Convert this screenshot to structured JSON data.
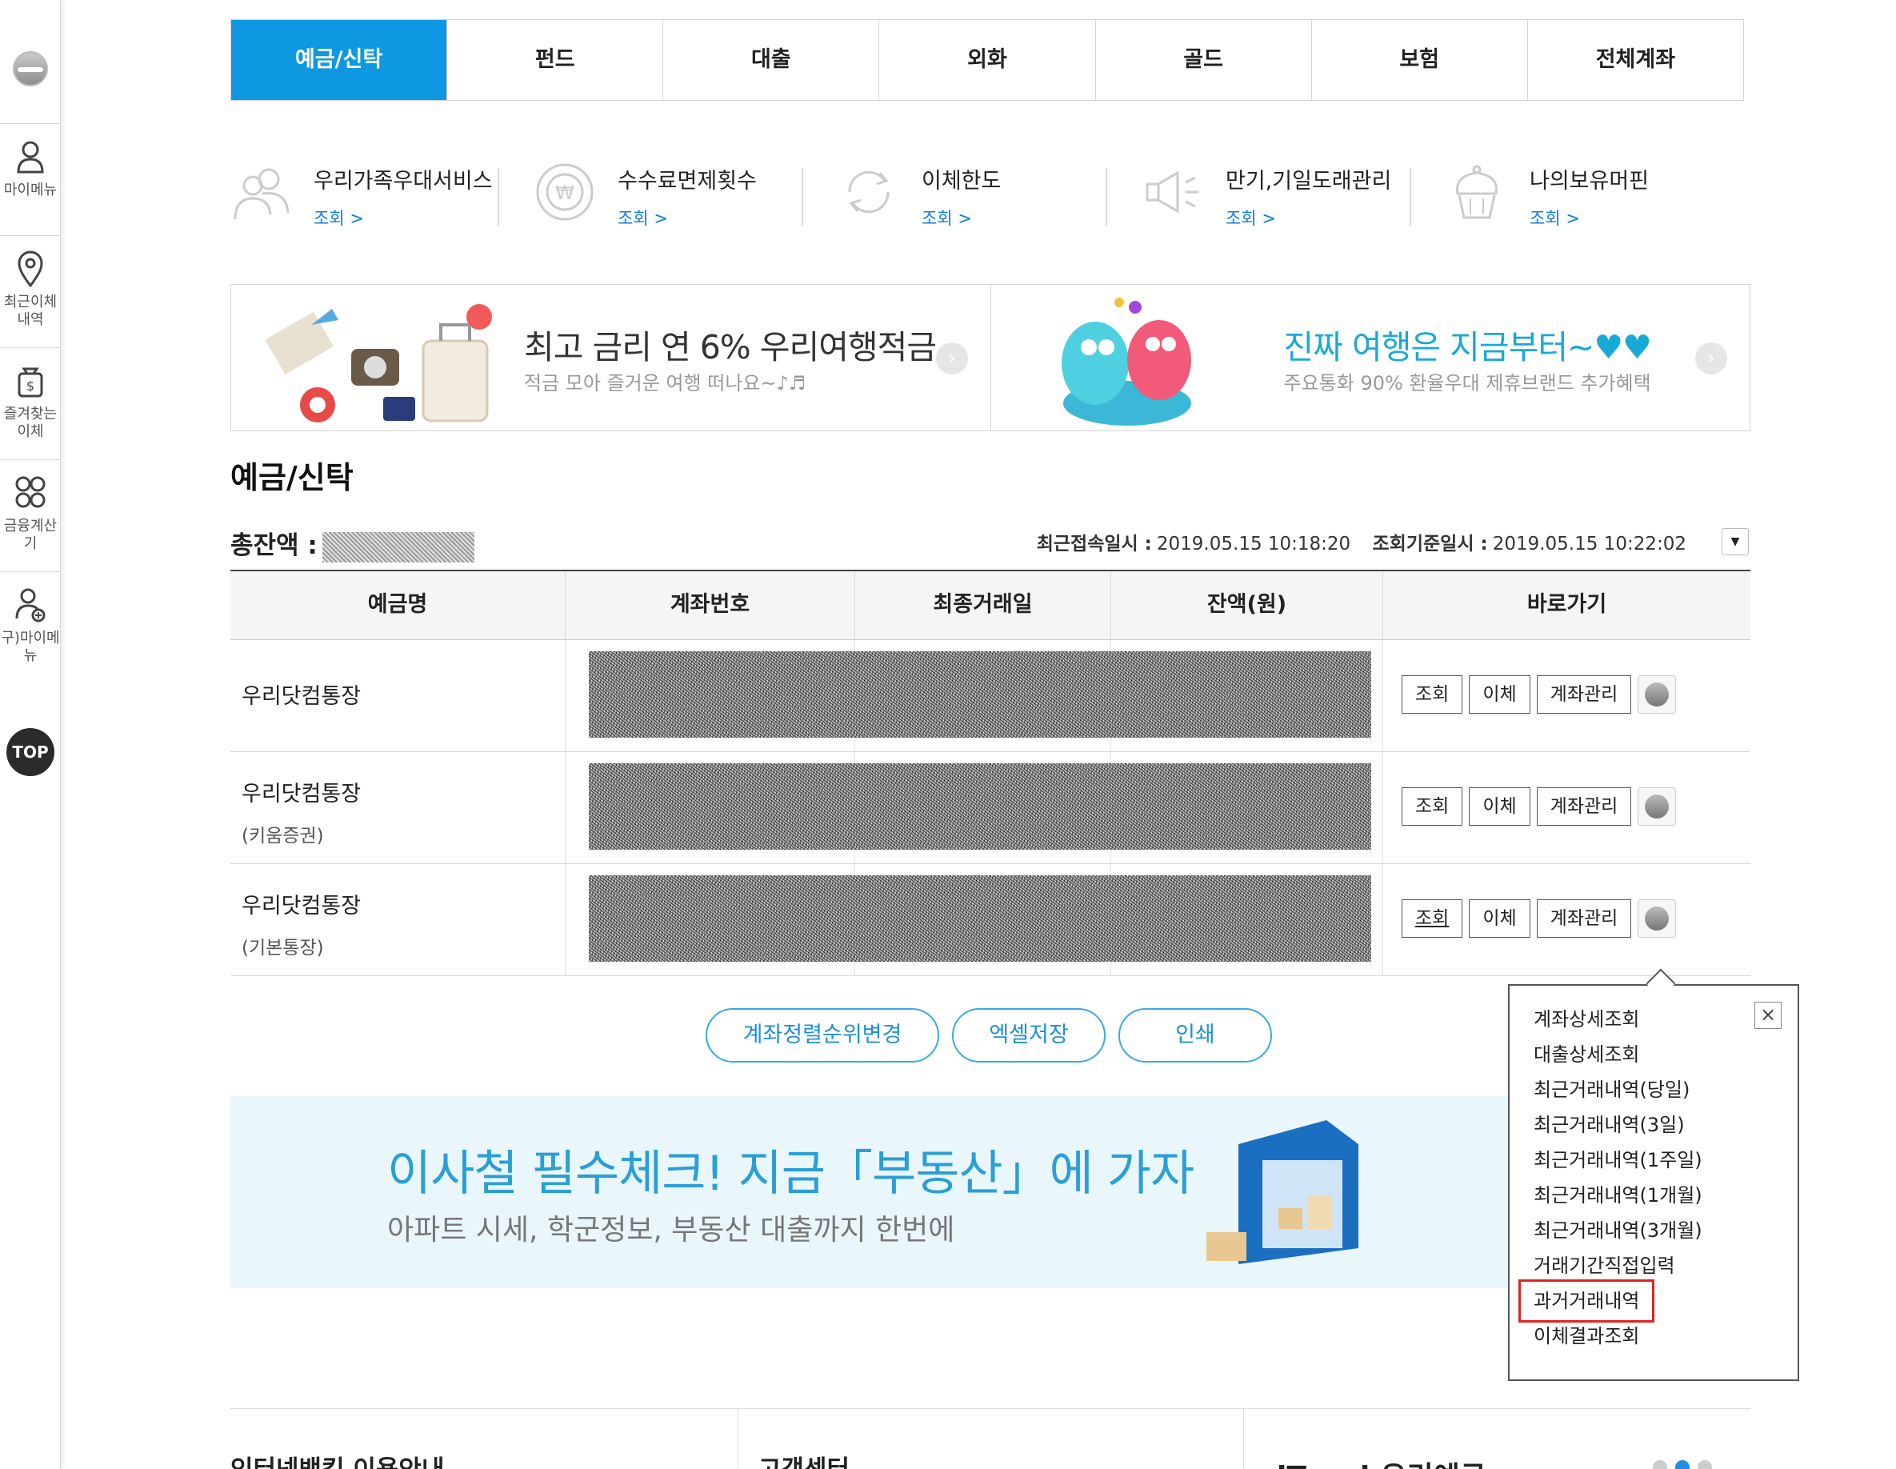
{
  "sidebar": {
    "items": [
      {
        "label": "마이메뉴",
        "icon": "person-icon"
      },
      {
        "label": "최근이체내역",
        "icon": "location-pin-icon"
      },
      {
        "label": "즐겨찾는이체",
        "icon": "money-bag-icon"
      },
      {
        "label": "금융계산기",
        "icon": "calculator-icon"
      },
      {
        "label": "구)마이메뉴",
        "icon": "person-add-icon"
      }
    ],
    "top": "TOP"
  },
  "tabs": [
    "예금/신탁",
    "펀드",
    "대출",
    "외화",
    "골드",
    "보험",
    "전체계좌"
  ],
  "quick": [
    {
      "title": "우리가족우대서비스",
      "link": "조회 >",
      "icon": "family-icon"
    },
    {
      "title": "수수료면제횟수",
      "link": "조회 >",
      "icon": "won-coin-icon"
    },
    {
      "title": "이체한도",
      "link": "조회 >",
      "icon": "refresh-icon"
    },
    {
      "title": "만기,기일도래관리",
      "link": "조회 >",
      "icon": "megaphone-icon"
    },
    {
      "title": "나의보유머핀",
      "link": "조회 >",
      "icon": "muffin-icon"
    }
  ],
  "banners": [
    {
      "title": "최고 금리 연 6% 우리여행적금",
      "sub": "적금 모아 즐거운 여행 떠나요~♪♬"
    },
    {
      "title": "진짜 여행은 지금부터~♥♥",
      "sub": "주요통화 90% 환율우대 제휴브랜드 추가혜택"
    }
  ],
  "section": {
    "title": "예금/신탁",
    "total_label": "총잔액 :",
    "last_access_label": "최근접속일시 :",
    "last_access": "2019.05.15 10:18:20",
    "query_time_label": "조회기준일시 :",
    "query_time": "2019.05.15 10:22:02"
  },
  "table": {
    "headers": [
      "예금명",
      "계좌번호",
      "최종거래일",
      "잔액(원)",
      "바로가기"
    ],
    "rows": [
      {
        "name": "우리닷컴통장",
        "sub": ""
      },
      {
        "name": "우리닷컴통장",
        "sub": "(키움증권)"
      },
      {
        "name": "우리닷컴통장",
        "sub": "(기본통장)"
      }
    ],
    "actions": {
      "view": "조회",
      "transfer": "이체",
      "manage": "계좌관리"
    }
  },
  "buttons": {
    "sort": "계좌정렬순위변경",
    "excel": "엑셀저장",
    "print": "인쇄"
  },
  "ad": {
    "title": "이사철 필수체크! 지금「부동산」에 가자",
    "sub": "아파트 시세, 학군정보, 부동산 대출까지 한번에"
  },
  "footer": {
    "guide": "인터넷뱅킹 이용안내",
    "center": "고객센터",
    "itouch": "iTouch우리예금"
  },
  "popup": {
    "items": [
      "계좌상세조회",
      "대출상세조회",
      "최근거래내역(당일)",
      "최근거래내역(3일)",
      "최근거래내역(1주일)",
      "최근거래내역(1개월)",
      "최근거래내역(3개월)",
      "거래기간직접입력",
      "과거거래내역",
      "이체결과조회"
    ],
    "highlighted": "과거거래내역",
    "close": "×"
  },
  "colors": {
    "accent": "#0f98e2",
    "highlight_box": "#e42020",
    "link": "#0f7fd6"
  }
}
